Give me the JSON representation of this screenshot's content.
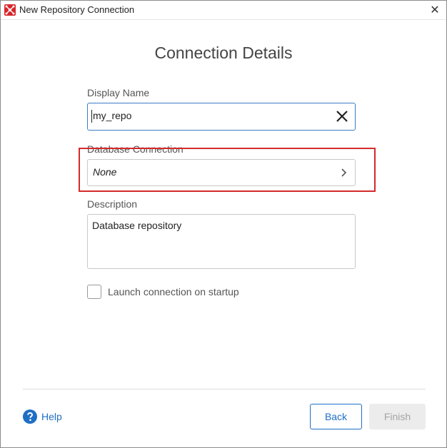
{
  "window": {
    "title": "New Repository Connection",
    "close_glyph": "✕"
  },
  "page": {
    "heading": "Connection Details"
  },
  "display_name": {
    "label": "Display Name",
    "value": "my_repo"
  },
  "database_connection": {
    "label": "Database Connection",
    "value": "None"
  },
  "description": {
    "label": "Description",
    "value": "Database repository"
  },
  "startup": {
    "label": "Launch connection on startup",
    "checked": false
  },
  "footer": {
    "help_label": "Help",
    "back_label": "Back",
    "finish_label": "Finish"
  },
  "colors": {
    "accent": "#1f6fc5",
    "highlight": "#d42a2a",
    "app_icon": "#d9262c"
  },
  "icons": {
    "app": "app-logo-icon",
    "close": "close-icon",
    "clear": "clear-x-icon",
    "chevron": "chevron-right-icon",
    "help": "help-icon"
  }
}
